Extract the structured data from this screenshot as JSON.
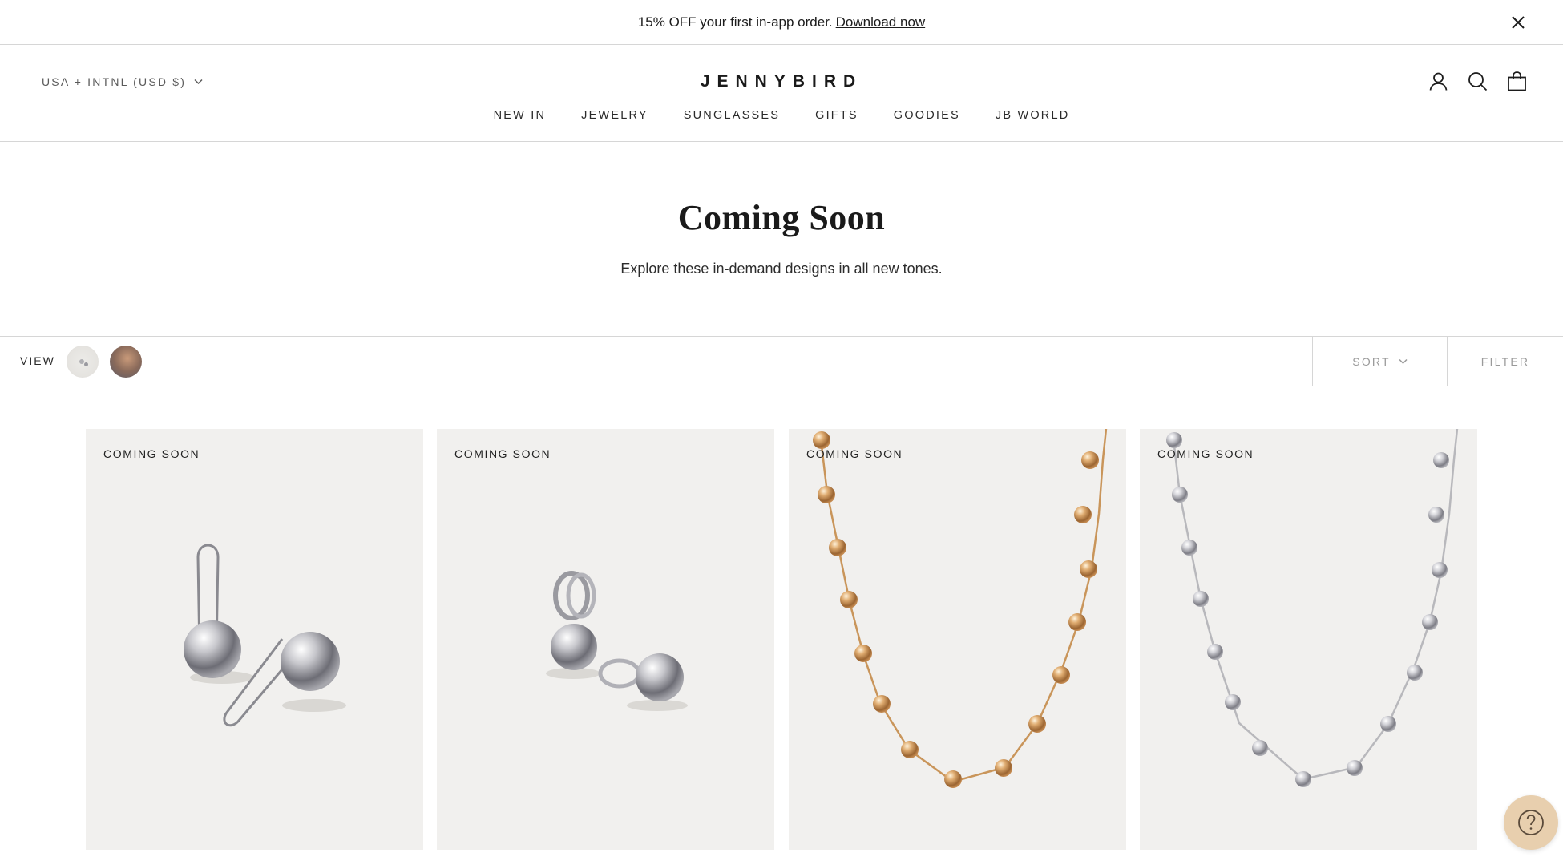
{
  "announcement": {
    "text": "15% OFF your first in-app order.",
    "link": "Download now"
  },
  "header": {
    "currency": "USA + INTNL (USD $)",
    "logo": "JENNYBIRD",
    "nav": [
      "NEW IN",
      "JEWELRY",
      "SUNGLASSES",
      "GIFTS",
      "GOODIES",
      "JB WORLD"
    ],
    "icons": [
      "account-icon",
      "search-icon",
      "bag-icon"
    ]
  },
  "hero": {
    "title": "Coming Soon",
    "subtitle": "Explore these in-demand designs in all new tones."
  },
  "toolbar": {
    "view_label": "VIEW",
    "sort_label": "SORT",
    "filter_label": "FILTER"
  },
  "products": [
    {
      "badge": "COMING SOON",
      "image": "silver-ball-drop-earrings"
    },
    {
      "badge": "COMING SOON",
      "image": "silver-ball-huggie-earrings"
    },
    {
      "badge": "COMING SOON",
      "image": "gold-ball-chain-necklace"
    },
    {
      "badge": "COMING SOON",
      "image": "silver-ball-chain-necklace"
    }
  ],
  "colors": {
    "card_bg": "#f1f0ee",
    "gold": "#c9955a",
    "silver": "#b8b8bc",
    "help_bg": "#e8cfae"
  }
}
